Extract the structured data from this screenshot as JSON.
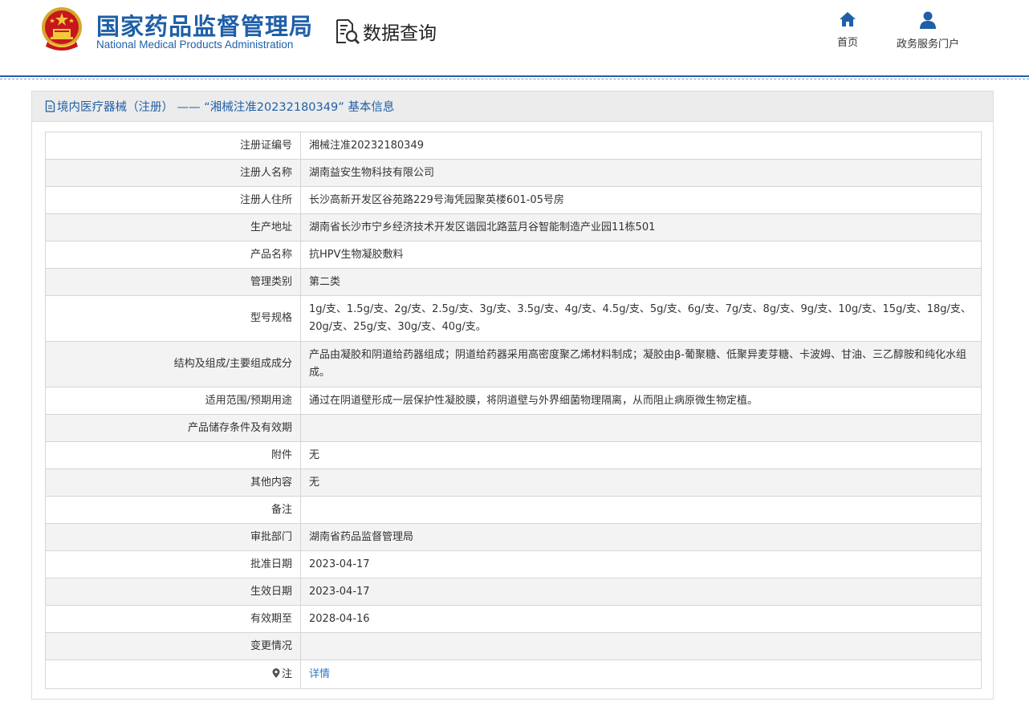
{
  "header": {
    "brand_cn": "国家药品监督管理局",
    "brand_en": "National Medical Products Administration",
    "section": "数据查询",
    "nav": [
      {
        "label": "首页",
        "icon": "home-icon"
      },
      {
        "label": "政务服务门户",
        "icon": "user-icon"
      }
    ]
  },
  "panel": {
    "title": "境内医疗器械（注册） —— “湘械注准20232180349” 基本信息"
  },
  "rows": [
    {
      "k": "注册证编号",
      "v": "湘械注准20232180349"
    },
    {
      "k": "注册人名称",
      "v": "湖南益安生物科技有限公司"
    },
    {
      "k": "注册人住所",
      "v": "长沙高新开发区谷苑路229号海凭园聚英楼601-05号房"
    },
    {
      "k": "生产地址",
      "v": "湖南省长沙市宁乡经济技术开发区谐园北路蓝月谷智能制造产业园11栋501"
    },
    {
      "k": "产品名称",
      "v": "抗HPV生物凝胶敷料"
    },
    {
      "k": "管理类别",
      "v": "第二类"
    },
    {
      "k": "型号规格",
      "v": "1g/支、1.5g/支、2g/支、2.5g/支、3g/支、3.5g/支、4g/支、4.5g/支、5g/支、6g/支、7g/支、8g/支、9g/支、10g/支、15g/支、18g/支、20g/支、25g/支、30g/支、40g/支。"
    },
    {
      "k": "结构及组成/主要组成成分",
      "v": "产品由凝胶和阴道给药器组成；阴道给药器采用高密度聚乙烯材料制成；凝胶由β-葡聚糖、低聚异麦芽糖、卡波姆、甘油、三乙醇胺和纯化水组成。"
    },
    {
      "k": "适用范围/预期用途",
      "v": "通过在阴道壁形成一层保护性凝胶膜，将阴道壁与外界细菌物理隔离，从而阻止病原微生物定植。"
    },
    {
      "k": "产品储存条件及有效期",
      "v": ""
    },
    {
      "k": "附件",
      "v": "无"
    },
    {
      "k": "其他内容",
      "v": "无"
    },
    {
      "k": "备注",
      "v": ""
    },
    {
      "k": "审批部门",
      "v": "湖南省药品监督管理局"
    },
    {
      "k": "批准日期",
      "v": "2023-04-17"
    },
    {
      "k": "生效日期",
      "v": "2023-04-17"
    },
    {
      "k": "有效期至",
      "v": "2028-04-16"
    },
    {
      "k": "变更情况",
      "v": ""
    }
  ],
  "note": {
    "k": "注",
    "link": "详情",
    "icon": "location-pin-icon"
  }
}
